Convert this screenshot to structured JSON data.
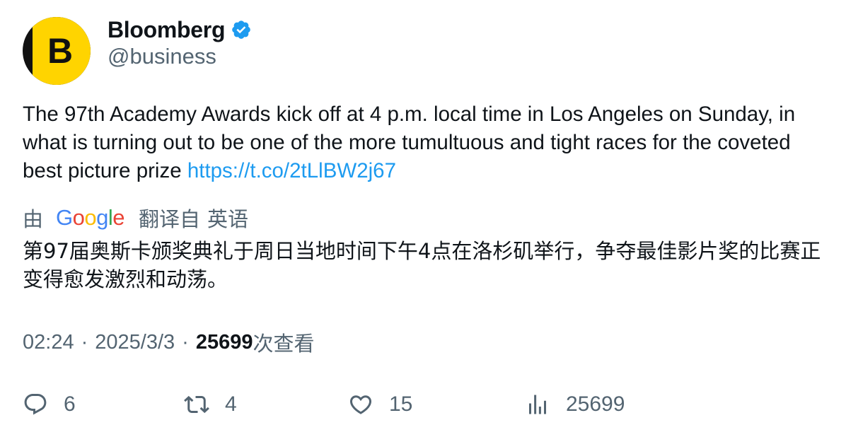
{
  "account": {
    "display_name": "Bloomberg",
    "handle": "@business",
    "avatar_letter": "B",
    "verified": true
  },
  "tweet": {
    "text": "The 97th Academy Awards kick off at 4 p.m. local time in Los Angeles on Sunday, in what is turning out to be one of the more tumultuous and tight races for the coveted best picture prize",
    "link": "https://t.co/2tLlBW2j67"
  },
  "translation": {
    "by": "由",
    "provider": "Google",
    "from_label": "翻译自",
    "language": "英语",
    "text": "第97届奥斯卡颁奖典礼于周日当地时间下午4点在洛杉矶举行，争夺最佳影片奖的比赛正变得愈发激烈和动荡。"
  },
  "meta": {
    "time": "02:24",
    "separator": "·",
    "date": "2025/3/3",
    "views_count": "25699",
    "views_label": "次查看"
  },
  "actions": {
    "replies": "6",
    "retweets": "4",
    "likes": "15",
    "views": "25699"
  },
  "colors": {
    "text": "#0f1419",
    "secondary": "#536471",
    "link": "#1d9bf0",
    "verified": "#1d9bf0",
    "avatar_yellow": "#ffd400",
    "avatar_dark": "#111111"
  },
  "icons": {
    "verified": "verified-badge-icon",
    "reply": "reply-icon",
    "retweet": "retweet-icon",
    "like": "heart-icon",
    "views": "analytics-bars-icon"
  }
}
